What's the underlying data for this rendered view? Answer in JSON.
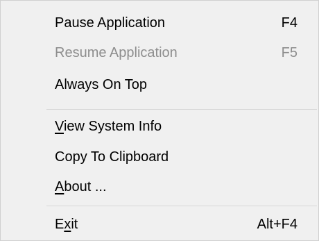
{
  "menu": {
    "items": [
      {
        "label": "Pause Application",
        "shortcut": "F4",
        "enabled": true
      },
      {
        "label": "Resume Application",
        "shortcut": "F5",
        "enabled": false
      },
      {
        "label": "Always On Top",
        "shortcut": "",
        "enabled": true
      },
      {
        "label_underlined_char": "V",
        "label_rest": "iew System Info",
        "shortcut": "",
        "enabled": true
      },
      {
        "label": "Copy To Clipboard",
        "shortcut": "",
        "enabled": true
      },
      {
        "label_underlined_char": "A",
        "label_rest": "bout ...",
        "shortcut": "",
        "enabled": true
      },
      {
        "label_prefix": "E",
        "label_underlined_char": "x",
        "label_rest": "it",
        "shortcut": "Alt+F4",
        "enabled": true
      }
    ]
  },
  "colors": {
    "background": "#f0f0f0",
    "text": "#000000",
    "disabled_text": "#8d8d8d",
    "separator": "#d7d7d7"
  }
}
